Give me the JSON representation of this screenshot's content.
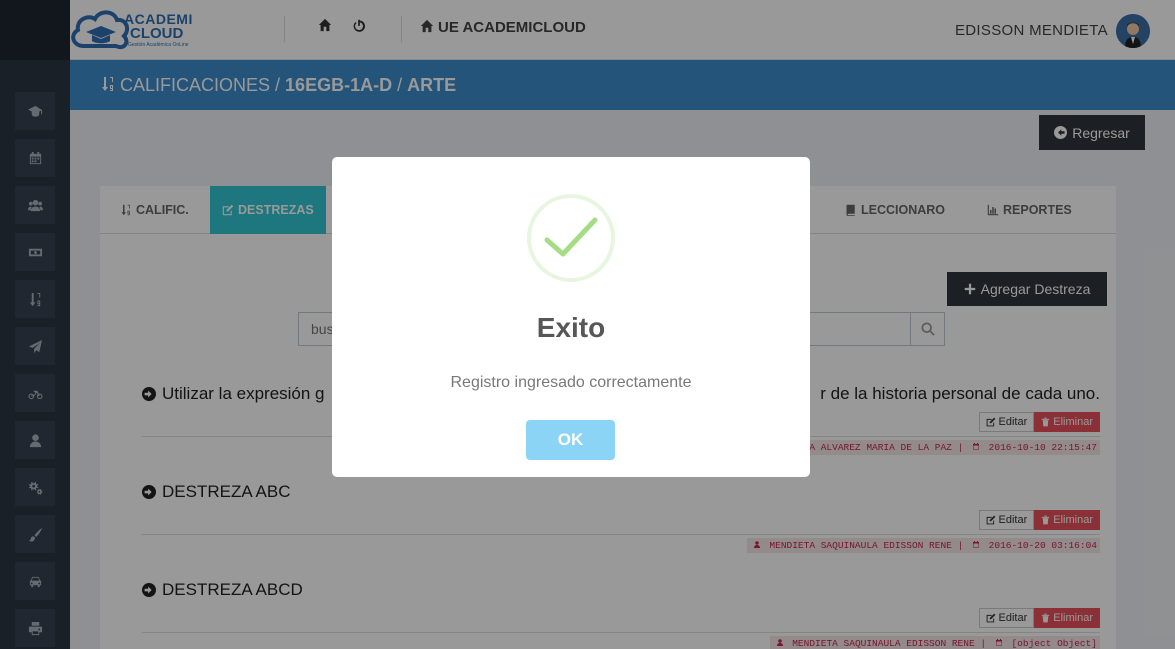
{
  "header": {
    "logo_line1": "ACADEMI",
    "logo_line2": "CLOUD",
    "logo_tagline": "Gestión Académica OnLine",
    "school_name": "UE ACADEMICLOUD",
    "user_name": "EDISSON MENDIETA"
  },
  "sidebar": {
    "icons": [
      "graduation-cap-icon",
      "calendar-icon",
      "users-icon",
      "money-icon",
      "sort-numeric-icon",
      "paper-plane-icon",
      "bicycle-icon",
      "user-icon",
      "cogs-icon",
      "paint-brush-icon",
      "car-icon",
      "print-icon"
    ]
  },
  "breadcrumb": {
    "root": "CALIFICACIONES",
    "sep1": " / ",
    "course": "16EGB-1A-D",
    "sep2": " / ",
    "subject": "ARTE"
  },
  "toolbar": {
    "back_label": "Regresar",
    "add_label": "Agregar Destreza"
  },
  "tabs": [
    {
      "label": "CALIFIC."
    },
    {
      "label": "DESTREZAS"
    },
    {
      "label": "LECCIONARO"
    },
    {
      "label": "REPORTES"
    }
  ],
  "search": {
    "placeholder": "bus"
  },
  "items": [
    {
      "title_start": "Utilizar la expresión g",
      "title_end": "r de la historia personal de cada uno.",
      "edit_label": "Editar",
      "delete_label": "Eliminar",
      "author": "VIA ALVAREZ MARIA DE LA PAZ",
      "separator": "|",
      "date": "2016-10-10 22:15:47"
    },
    {
      "title": "DESTREZA ABC",
      "edit_label": "Editar",
      "delete_label": "Eliminar",
      "author": "MENDIETA SAQUINAULA EDISSON RENE",
      "separator": "|",
      "date": "2016-10-20 03:16:04"
    },
    {
      "title": "DESTREZA ABCD",
      "edit_label": "Editar",
      "delete_label": "Eliminar",
      "author": "MENDIETA SAQUINAULA EDISSON RENE",
      "separator": "|",
      "date": "[object Object]"
    }
  ],
  "modal": {
    "title": "Exito",
    "message": "Registro ingresado correctamente",
    "ok_label": "OK",
    "check_color": "#a5dc86",
    "button_color": "#8cd4f5"
  }
}
